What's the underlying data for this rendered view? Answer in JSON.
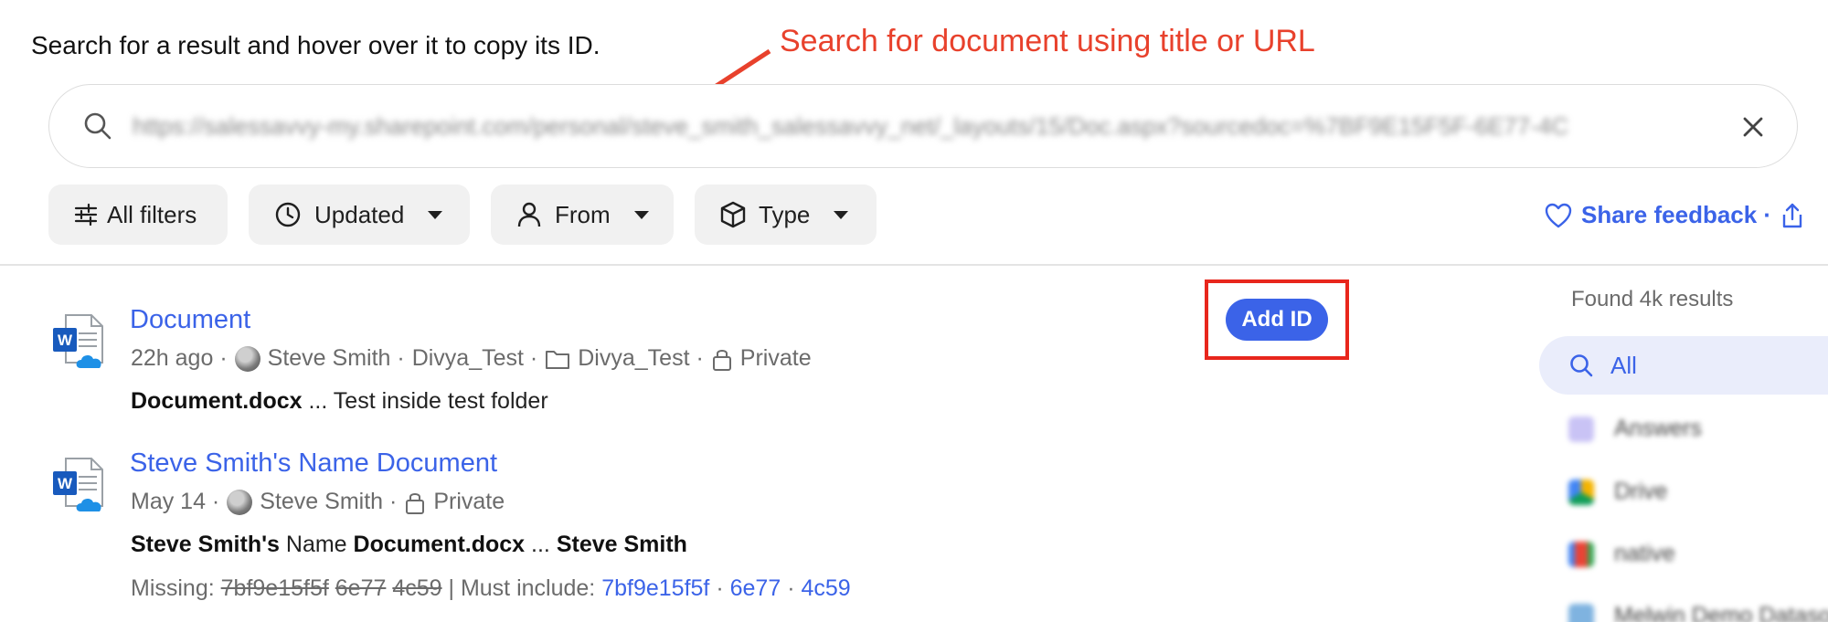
{
  "instruction": "Search for a result and hover over it to copy its ID.",
  "annotation": {
    "text": "Search for document using title or URL",
    "color": "#e8412c"
  },
  "search": {
    "value": "https://salessavvy-my.sharepoint.com/personal/steve_smith_salessavvy_net/_layouts/15/Doc.aspx?sourcedoc=%7BF9E15F5F-6E77-4C"
  },
  "filters": {
    "all_label": "All filters",
    "updated_label": "Updated",
    "from_label": "From",
    "type_label": "Type"
  },
  "feedback": {
    "label": "Share feedback ·"
  },
  "results": [
    {
      "title": "Document",
      "time": "22h ago ·",
      "author": "Steve Smith ·",
      "source": "Divya_Test ·",
      "folder": "Divya_Test ·",
      "privacy": "Private",
      "snippet_bold": "Document.docx",
      "snippet_rest": " ... Test inside test folder"
    },
    {
      "title": "Steve Smith's Name Document",
      "time": "May 14 ·",
      "author": "Steve Smith ·",
      "privacy": "Private",
      "snippet_parts": [
        "Steve Smith's",
        " Name ",
        "Document.docx",
        " ... ",
        "Steve Smith"
      ],
      "missing_label": "Missing:",
      "missing_tokens": [
        "7bf9e15f5f",
        "6e77",
        "4c59"
      ],
      "must_label": "| Must include:",
      "must_tokens": [
        "7bf9e15f5f",
        "6e77",
        "4c59"
      ],
      "sep": "·"
    }
  ],
  "add_id_label": "Add ID",
  "sidebar": {
    "found": "Found 4k results",
    "items": [
      {
        "label": "All",
        "icon": "search-icon"
      },
      {
        "label": "Answers",
        "icon": "answers-icon"
      },
      {
        "label": "Drive",
        "icon": "drive-icon"
      },
      {
        "label": "native",
        "icon": "gmail-icon"
      },
      {
        "label": "Melwin Demo Datasource",
        "icon": "datasource-icon"
      }
    ]
  },
  "colors": {
    "accent": "#3b63e8",
    "highlight_frame": "#e8261c"
  }
}
